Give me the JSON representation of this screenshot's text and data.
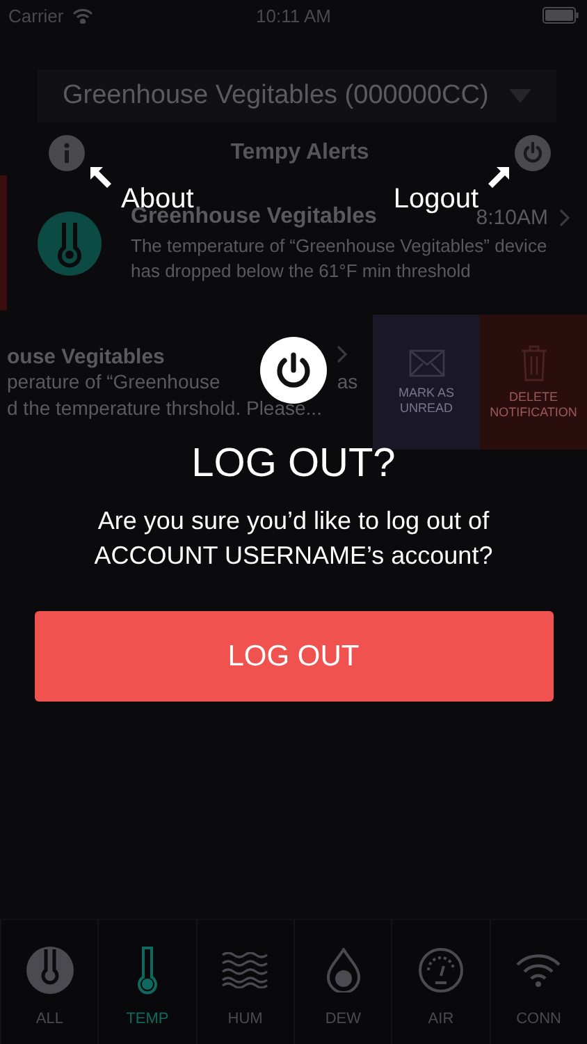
{
  "status_bar": {
    "carrier": "Carrier",
    "time": "10:11 AM"
  },
  "device_picker": {
    "value": "Greenhouse Vegitables (000000CC)"
  },
  "header": {
    "title": "Tempy Alerts"
  },
  "hints": [
    {
      "label": "About"
    },
    {
      "label": "Logout"
    }
  ],
  "alerts": [
    {
      "title": "Greenhouse Vegitables",
      "time": "8:10AM",
      "message": "The temperature of “Greenhouse Vegitables” device has dropped below the 61°F min threshold",
      "unread": true
    },
    {
      "title": "ouse Vegitables",
      "lines": [
        [
          "perature of  “Greenhouse",
          "as"
        ],
        [
          "d the temperature thrshold. Please..."
        ]
      ],
      "unread": false
    }
  ],
  "swipe_actions": [
    {
      "kind": "mark-unread",
      "label": "MARK AS UNREAD"
    },
    {
      "kind": "delete",
      "label": "DELETE NOTIFICATION"
    }
  ],
  "dialog": {
    "title": "LOG OUT?",
    "message": "Are you sure you’d like to log out of ACCOUNT USERNAME’s account?",
    "button": "LOG OUT"
  },
  "tabs": [
    {
      "kind": "all",
      "label": "ALL",
      "selected": false
    },
    {
      "kind": "temp",
      "label": "TEMP",
      "selected": true
    },
    {
      "kind": "hum",
      "label": "HUM",
      "selected": false
    },
    {
      "kind": "dew",
      "label": "DEW",
      "selected": false
    },
    {
      "kind": "air",
      "label": "AIR",
      "selected": false
    },
    {
      "kind": "conn",
      "label": "CONN",
      "selected": false
    }
  ]
}
